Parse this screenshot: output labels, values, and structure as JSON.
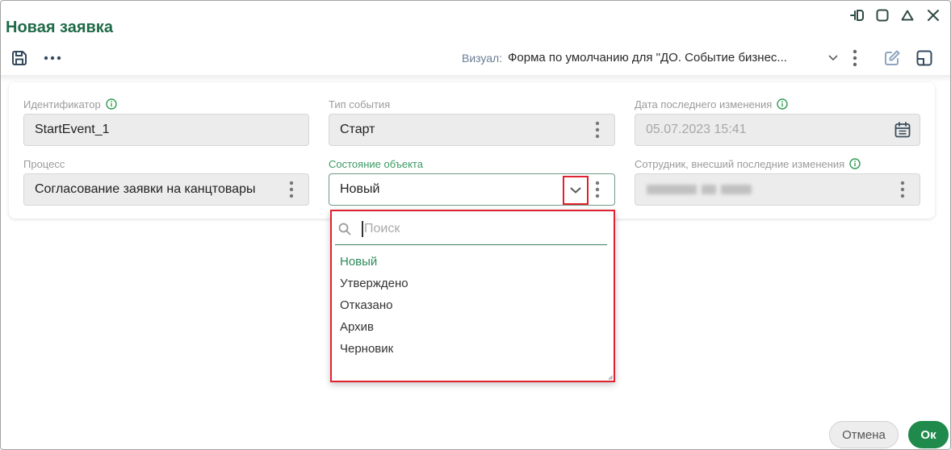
{
  "window": {
    "title": "Новая заявка",
    "controls": [
      "dock-icon",
      "maximize-icon",
      "collapse-icon",
      "close-icon"
    ]
  },
  "toolbar": {
    "icons": [
      "save-icon",
      "more-icon",
      "chevron-down-icon",
      "kebab-icon",
      "edit-icon",
      "layout-icon"
    ],
    "visual_label": "Визуал:",
    "visual_value": "Форма по умолчанию для \"ДО. Событие бизнес..."
  },
  "form": {
    "identifier": {
      "label": "Идентификатор",
      "value": "StartEvent_1",
      "icon": "info-icon"
    },
    "event_type": {
      "label": "Тип события",
      "value": "Старт"
    },
    "last_modified": {
      "label": "Дата последнего изменения",
      "value": "05.07.2023 15:41",
      "icon": "calendar-icon"
    },
    "process": {
      "label": "Процесс",
      "value": "Согласование заявки на канцтовары"
    },
    "object_state": {
      "label": "Состояние объекта",
      "value": "Новый"
    },
    "modified_by": {
      "label": "Сотрудник, внесший последние изменения"
    }
  },
  "dropdown": {
    "search_placeholder": "Поиск",
    "options": [
      "Новый",
      "Утверждено",
      "Отказано",
      "Архив",
      "Черновик"
    ],
    "selected_index": 0
  },
  "footer": {
    "cancel_label": "Отмена",
    "ok_label": "Ок"
  },
  "colors": {
    "accent": "#1f8a4c",
    "title": "#1f6a47",
    "highlight": "#e0212e",
    "label": "#9b9b9b",
    "field_bg": "#ececec",
    "state_label": "#3b9a63",
    "info": "#2e9b52",
    "selected_option": "#2b8a5a"
  }
}
